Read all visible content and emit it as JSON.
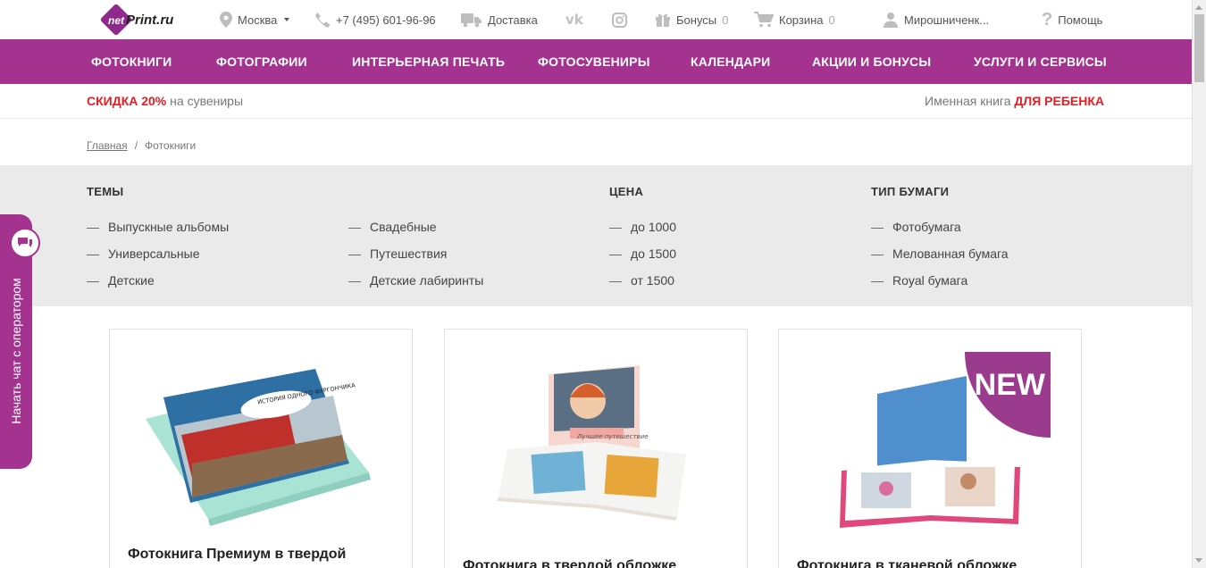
{
  "header": {
    "logo_text": "netPrint.ru",
    "logo_net": "net",
    "logo_print": "Print.ru",
    "city": "Москва",
    "phone": "+7 (495) 601-96-96",
    "delivery": "Доставка",
    "bonuses_label": "Бонусы",
    "bonuses_count": "0",
    "cart_label": "Корзина",
    "cart_count": "0",
    "user_name": "Мирошниченк...",
    "help": "Помощь"
  },
  "nav": {
    "items": [
      {
        "label": "ФОТОКНИГИ"
      },
      {
        "label": "ФОТОГРАФИИ"
      },
      {
        "label": "ИНТЕРЬЕРНАЯ ПЕЧАТЬ"
      },
      {
        "label": "ФОТОСУВЕНИРЫ"
      },
      {
        "label": "КАЛЕНДАРИ"
      },
      {
        "label": "АКЦИИ И БОНУСЫ"
      },
      {
        "label": "УСЛУГИ И СЕРВИСЫ"
      }
    ]
  },
  "promo": {
    "left_accent": "СКИДКА 20%",
    "left_text": "на сувениры",
    "right_text": "Именная книга",
    "right_accent": "ДЛЯ РЕБЕНКА"
  },
  "breadcrumb": {
    "home": "Главная",
    "separator": "/",
    "current": "Фотокниги"
  },
  "filters": {
    "themes": {
      "title": "ТЕМЫ",
      "items": [
        "Выпускные альбомы",
        "Универсальные",
        "Детские",
        "Свадебные",
        "Путешествия",
        "Детские лабиринты"
      ]
    },
    "price": {
      "title": "ЦЕНА",
      "items": [
        "до 1000",
        "до 1500",
        "от 1500"
      ]
    },
    "paper": {
      "title": "ТИП БУМАГИ",
      "items": [
        "Фотобумага",
        "Мелованная бумага",
        "Royal бумага"
      ]
    },
    "dash": "—"
  },
  "products": [
    {
      "title": "Фотокнига Премиум в твердой",
      "cover_text": "ИСТОРИЯ ОДНОГО ФУРГОНЧИКА"
    },
    {
      "title": "Фотокнига в твердой обложке",
      "cover_text": "Лучшее путешествие"
    },
    {
      "title": "Фотокнига в тканевой обложке",
      "badge": "NEW"
    }
  ],
  "chat": {
    "label": "Начать чат с оператором"
  },
  "colors": {
    "brand_purple": "#a3338f",
    "accent_red": "#e21d24"
  }
}
